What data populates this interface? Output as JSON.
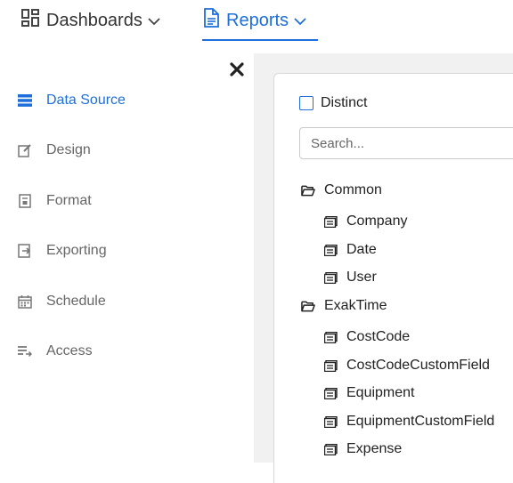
{
  "nav": {
    "dashboards": "Dashboards",
    "reports": "Reports"
  },
  "sidebar": {
    "items": [
      {
        "label": "Data Source",
        "icon": "list-icon",
        "active": true
      },
      {
        "label": "Design",
        "icon": "edit-icon"
      },
      {
        "label": "Format",
        "icon": "format-icon"
      },
      {
        "label": "Exporting",
        "icon": "export-icon"
      },
      {
        "label": "Schedule",
        "icon": "calendar-icon"
      },
      {
        "label": "Access",
        "icon": "access-icon"
      }
    ]
  },
  "main": {
    "distinct_label": "Distinct",
    "distinct_checked": false,
    "search_placeholder": "Search...",
    "tree": [
      {
        "label": "Common",
        "type": "folder",
        "children": [
          {
            "label": "Company"
          },
          {
            "label": "Date"
          },
          {
            "label": "User"
          }
        ]
      },
      {
        "label": "ExakTime",
        "type": "folder",
        "children": [
          {
            "label": "CostCode"
          },
          {
            "label": "CostCodeCustomField"
          },
          {
            "label": "Equipment"
          },
          {
            "label": "EquipmentCustomField"
          },
          {
            "label": "Expense"
          }
        ]
      }
    ]
  },
  "colors": {
    "accent": "#1e6fd9",
    "sidebar_text": "#666666",
    "main_background": "#f1f1f1"
  }
}
